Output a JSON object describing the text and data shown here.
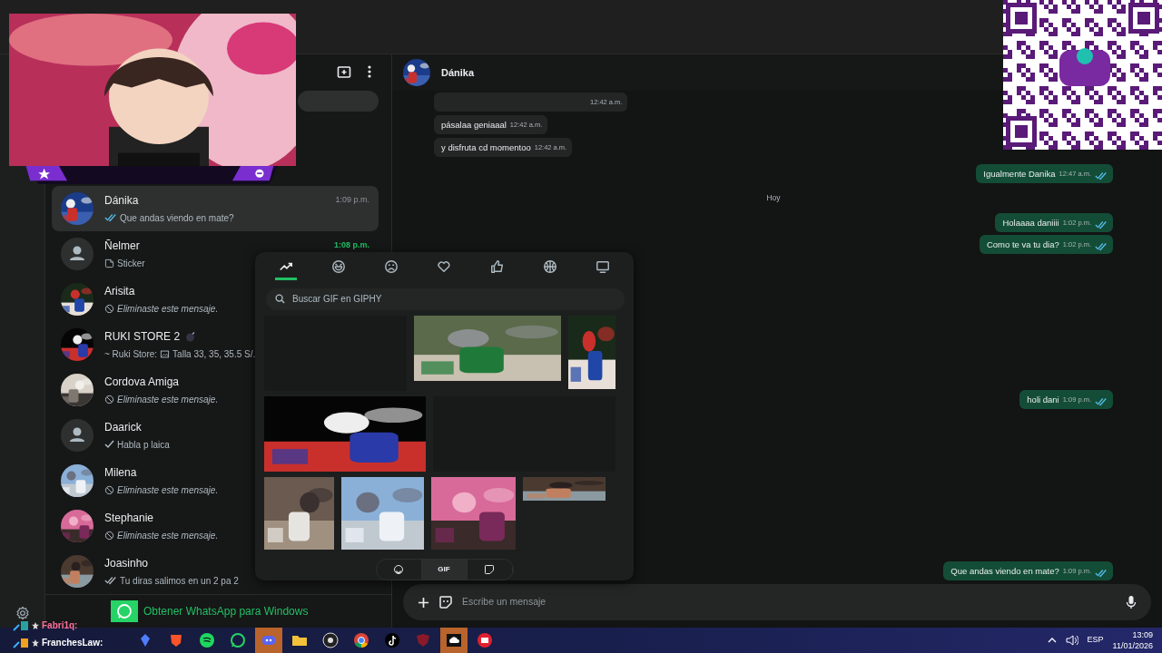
{
  "chat_list": {
    "items": [
      {
        "name": "Dánika",
        "photo": true,
        "time": "1:09 p.m.",
        "unread": false,
        "selected": true,
        "read": true,
        "kind": "text",
        "preview": "Que andas viendo en mate?"
      },
      {
        "name": "Ñelmer",
        "photo": false,
        "time": "1:08 p.m.",
        "unread": true,
        "selected": false,
        "kind": "sticker",
        "preview": "Sticker"
      },
      {
        "name": "Arisita",
        "photo": true,
        "selected": false,
        "kind": "deleted",
        "preview": "Eliminaste este mensaje."
      },
      {
        "name": "RUKI STORE 2",
        "photo": true,
        "selected": false,
        "author": "~ Ruki Store:",
        "preview": "Talla 33, 35, 35.5 S/."
      },
      {
        "name": "Cordova Amiga",
        "photo": true,
        "selected": false,
        "kind": "deleted",
        "preview": "Eliminaste este mensaje."
      },
      {
        "name": "Daarick",
        "photo": false,
        "selected": false,
        "delivered": false,
        "read": false,
        "kind": "text",
        "preview": "Habla p laica"
      },
      {
        "name": "Milena",
        "photo": true,
        "selected": false,
        "kind": "deleted",
        "preview": "Eliminaste este mensaje."
      },
      {
        "name": "Stephanie",
        "photo": true,
        "selected": false,
        "kind": "deleted",
        "preview": "Eliminaste este mensaje."
      },
      {
        "name": "Joasinho",
        "photo": true,
        "selected": false,
        "delivered": true,
        "read": false,
        "kind": "text",
        "preview": "Tu diras salimos en un 2 pa 2"
      }
    ],
    "promo": "Obtener WhatsApp para Windows"
  },
  "chat": {
    "contact": "Dánika",
    "messages": [
      {
        "kind": "in",
        "time": "12:42 a.m."
      },
      {
        "kind": "in",
        "text": "pásalaa geniaaal",
        "time": "12:42 a.m."
      },
      {
        "kind": "in",
        "text": "y disfruta cd momentoo",
        "time": "12:42 a.m."
      },
      {
        "kind": "out",
        "text": "Igualmente Danika",
        "time": "12:47 a.m.",
        "read": true
      },
      {
        "kind": "date",
        "text": "Hoy"
      },
      {
        "kind": "out",
        "text": "Holaaaa daniiii",
        "time": "1:02 p.m.",
        "read": true
      },
      {
        "kind": "out",
        "text": "Como te va tu dia?",
        "time": "1:02 p.m.",
        "read": true
      },
      {
        "kind": "out",
        "text": "holi dani",
        "time": "1:09 p.m.",
        "read": true
      },
      {
        "kind": "out",
        "text": "Que andas viendo en mate?",
        "time": "1:09 p.m.",
        "read": true
      }
    ],
    "composer": {
      "placeholder": "Escribe un mensaje"
    }
  },
  "gif_panel": {
    "categories": [
      {
        "kind": "trending",
        "selected": true
      },
      {
        "kind": "laugh",
        "selected": false
      },
      {
        "kind": "sad",
        "selected": false
      },
      {
        "kind": "love",
        "selected": false
      },
      {
        "kind": "like",
        "selected": false
      },
      {
        "kind": "sports",
        "selected": false
      },
      {
        "kind": "tv",
        "selected": false
      }
    ],
    "search": {
      "placeholder": "Buscar GIF en GIPHY"
    },
    "tiles": [
      {
        "kind": "blank"
      },
      {
        "kind": "picture"
      },
      {
        "kind": "picture"
      },
      {
        "kind": "picture"
      },
      {
        "kind": "blank"
      },
      {
        "kind": "picture"
      },
      {
        "kind": "picture"
      },
      {
        "kind": "picture"
      },
      {
        "kind": "picture"
      }
    ],
    "tabs": [
      {
        "kind": "emoji",
        "selected": false
      },
      {
        "kind": "gif",
        "label": "GIF",
        "selected": true
      },
      {
        "kind": "sticker",
        "selected": false
      }
    ]
  },
  "stream_chat": [
    {
      "user": "Fabri1q:"
    },
    {
      "user": "FranchesLaw:"
    }
  ],
  "taskbar": {
    "apps": [
      {
        "kind": "blue",
        "active": false
      },
      {
        "kind": "brave",
        "active": false
      },
      {
        "kind": "spotify",
        "active": false
      },
      {
        "kind": "whatsapp",
        "active": false
      },
      {
        "kind": "discord",
        "active": true
      },
      {
        "kind": "folder",
        "active": false
      },
      {
        "kind": "obs",
        "active": false
      },
      {
        "kind": "chrome",
        "active": false
      },
      {
        "kind": "tiktok",
        "active": false
      },
      {
        "kind": "shield",
        "active": false
      },
      {
        "kind": "cloud",
        "active": true
      },
      {
        "kind": "red",
        "active": false
      }
    ],
    "language": "ESP",
    "time": "13:09",
    "date": "11/01/2026"
  }
}
